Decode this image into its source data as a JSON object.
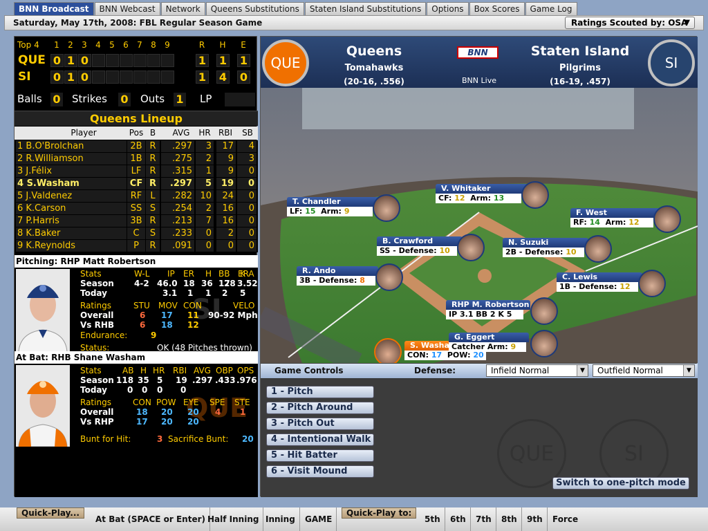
{
  "tabs": [
    {
      "label": "BNN Broadcast"
    },
    {
      "label": "BNN Webcast"
    },
    {
      "label": "Network"
    },
    {
      "label": "Queens Substitutions"
    },
    {
      "label": "Staten Island Substitutions"
    },
    {
      "label": "Options"
    },
    {
      "label": "Box Scores"
    },
    {
      "label": "Game Log"
    }
  ],
  "date_line": "Saturday, May 17th, 2008: FBL Regular Season Game",
  "scouted_by": "Ratings Scouted by: OSA",
  "linescore": {
    "inning_label": "Top 4",
    "innings": [
      "1",
      "2",
      "3",
      "4",
      "5",
      "6",
      "7",
      "8",
      "9"
    ],
    "rhe": [
      "R",
      "H",
      "E"
    ],
    "away": {
      "abbr": "QUE",
      "runs": [
        "0",
        "1",
        "0"
      ],
      "r": "1",
      "h": "1",
      "e": "1"
    },
    "home": {
      "abbr": "SI",
      "runs": [
        "0",
        "1",
        "0"
      ],
      "r": "1",
      "h": "4",
      "e": "0"
    }
  },
  "count": {
    "balls_label": "Balls",
    "balls": "0",
    "strikes_label": "Strikes",
    "strikes": "0",
    "outs_label": "Outs",
    "outs": "1",
    "lp_label": "LP"
  },
  "lineup": {
    "title": "Queens Lineup",
    "headers": [
      "Player",
      "Pos",
      "B",
      "AVG",
      "HR",
      "RBI",
      "SB"
    ],
    "rows": [
      [
        "1 B.O'Brolchan",
        "2B",
        "R",
        ".297",
        "3",
        "17",
        "4"
      ],
      [
        "2 R.Williamson",
        "1B",
        "R",
        ".275",
        "2",
        "9",
        "3"
      ],
      [
        "3 J.Félix",
        "LF",
        "R",
        ".315",
        "1",
        "9",
        "0"
      ],
      [
        "4 S.Washam",
        "CF",
        "R",
        ".297",
        "5",
        "19",
        "0"
      ],
      [
        "5 J.Valdenez",
        "RF",
        "L",
        ".282",
        "10",
        "24",
        "0"
      ],
      [
        "6 K.Carson",
        "SS",
        "S",
        ".254",
        "2",
        "16",
        "0"
      ],
      [
        "7 P.Harris",
        "3B",
        "R",
        ".213",
        "7",
        "16",
        "0"
      ],
      [
        "8 K.Baker",
        "C",
        "S",
        ".233",
        "0",
        "2",
        "0"
      ],
      [
        "9 K.Reynolds",
        "P",
        "R",
        ".091",
        "0",
        "0",
        "0"
      ]
    ]
  },
  "pitcher": {
    "header": "Pitching: RHP Matt Robertson",
    "stat_headers": [
      "Stats",
      "W-L",
      "IP",
      "ER",
      "H",
      "BB",
      "K",
      "ERA"
    ],
    "season": [
      "Season",
      "4-2",
      "46.0",
      "18",
      "36",
      "17",
      "28",
      "3.52"
    ],
    "today": [
      "Today",
      "",
      "3.1",
      "1",
      "1",
      "2",
      "5",
      ""
    ],
    "ratings_headers": [
      "Ratings",
      "STU",
      "MOV",
      "CON",
      "VELO"
    ],
    "overall": [
      "Overall",
      "6",
      "17",
      "11",
      "90-92 Mph"
    ],
    "vs": [
      "Vs RHB",
      "6",
      "18",
      "12"
    ],
    "endurance_label": "Endurance:",
    "endurance": "9",
    "status_label": "Status:",
    "status": "OK (48 Pitches thrown)",
    "bg_logo": "SI"
  },
  "batter": {
    "header": "At Bat: RHB Shane Washam",
    "stat_headers": [
      "Stats",
      "AB",
      "H",
      "HR",
      "RBI",
      "AVG",
      "OBP",
      "OPS"
    ],
    "season": [
      "Season",
      "118",
      "35",
      "5",
      "19",
      ".297",
      ".433",
      ".976"
    ],
    "today": [
      "Today",
      "0",
      "0",
      "0",
      "0"
    ],
    "ratings_headers": [
      "Ratings",
      "CON",
      "POW",
      "EYE",
      "SPE",
      "STE"
    ],
    "overall": [
      "Overall",
      "18",
      "20",
      "20",
      "4",
      "1"
    ],
    "vs": [
      "Vs RHP",
      "17",
      "20",
      "20"
    ],
    "bunt_hit_label": "Bunt for Hit:",
    "bunt_hit": "3",
    "sac_bunt_label": "Sacrifice Bunt:",
    "sac_bunt": "20",
    "bg_logo": "QUE"
  },
  "scoreboard": {
    "away_logo": "QUE",
    "away_name": "Queens",
    "away_nick": "Tomahawks",
    "away_record": "(20-16, .556)",
    "home_logo": "SI",
    "home_name": "Staten Island",
    "home_nick": "Pilgrims",
    "home_record": "(16-19, .457)",
    "network_logo": "BNN",
    "network_label": "BNN Live"
  },
  "field_cards": {
    "whitaker": {
      "name": "V. Whitaker",
      "pos": "CF:",
      "v1": "12",
      "label2": "Arm:",
      "v2": "13"
    },
    "chandler": {
      "name": "T. Chandler",
      "pos": "LF:",
      "v1": "15",
      "label2": "Arm:",
      "v2": "9"
    },
    "west": {
      "name": "F. West",
      "pos": "RF:",
      "v1": "14",
      "label2": "Arm:",
      "v2": "12"
    },
    "crawford": {
      "name": "B. Crawford",
      "pos": "SS - Defense:",
      "v1": "10"
    },
    "suzuki": {
      "name": "N. Suzuki",
      "pos": "2B - Defense:",
      "v1": "10"
    },
    "ando": {
      "name": "R. Ando",
      "pos": "3B - Defense:",
      "v1": "8"
    },
    "lewis": {
      "name": "C. Lewis",
      "pos": "1B - Defense:",
      "v1": "12"
    },
    "robertson": {
      "name": "RHP M. Robertson",
      "line": "IP 3.1  BB 2  K 5"
    },
    "washam": {
      "name": "S. Washam",
      "con_label": "CON:",
      "con": "17",
      "pow_label": "POW:",
      "pow": "20"
    },
    "eggert": {
      "name": "G. Eggert",
      "pos": "Catcher Arm:",
      "v1": "9"
    }
  },
  "game_controls": {
    "title": "Game Controls",
    "defense_label": "Defense:",
    "infield": "Infield Normal",
    "outfield": "Outfield Normal",
    "buttons": [
      "1 - Pitch",
      "2 - Pitch Around",
      "3 - Pitch Out",
      "4 - Intentional Walk",
      "5 - Hit Batter",
      "6 - Visit Mound"
    ],
    "one_pitch": "Switch to one-pitch mode",
    "bg_logos": [
      "QUE",
      "SI"
    ]
  },
  "bottom": {
    "quickplay1": "Quick-Play...",
    "quickplay2": "Quick-Play to:",
    "items": [
      "At Bat (SPACE or Enter)",
      "Half Inning",
      "Inning",
      "GAME"
    ],
    "innings": [
      "5th",
      "6th",
      "7th",
      "8th",
      "9th",
      "Force"
    ]
  },
  "colors": {
    "accent": "#ffcc00",
    "tab_active": "#2c4f9b",
    "que_orange": "#f07000",
    "si_blue": "#27446e"
  }
}
